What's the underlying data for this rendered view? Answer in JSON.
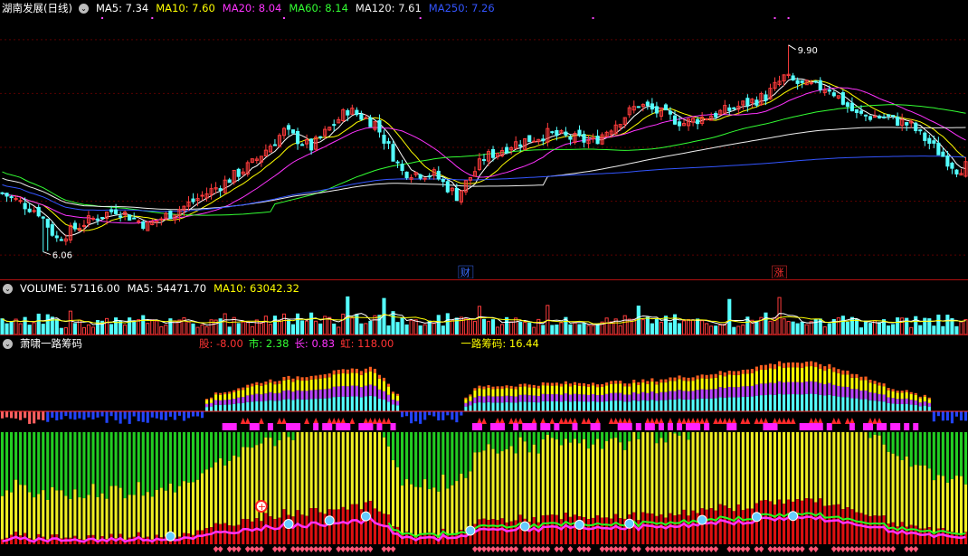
{
  "colors": {
    "up": "#ff3c3c",
    "down": "#54ffff",
    "ma5": "#ffffff",
    "ma10": "#ffff00",
    "ma20": "#ff33ff",
    "ma60": "#33ff33",
    "ma120": "#eeeeee",
    "ma250": "#3355ff",
    "grid": "#5a0000"
  },
  "price_panel": {
    "title": "湖南发展(日线)",
    "ma_labels": [
      {
        "text": "MA5: 7.34",
        "color": "#ffffff"
      },
      {
        "text": "MA10: 7.60",
        "color": "#ffff00"
      },
      {
        "text": "MA20: 8.04",
        "color": "#ff33ff"
      },
      {
        "text": "MA60: 8.14",
        "color": "#33ff33"
      },
      {
        "text": "MA120: 7.61",
        "color": "#eeeeee"
      },
      {
        "text": "MA250: 7.26",
        "color": "#3355ff"
      }
    ],
    "high_label": "9.90",
    "low_label": "6.06",
    "markers": [
      {
        "text": "财",
        "color": "#3a6cff"
      },
      {
        "text": "涨",
        "color": "#ff3030"
      }
    ]
  },
  "volume_panel": {
    "labels": [
      {
        "text": "VOLUME: 57116.00",
        "color": "#ffffff"
      },
      {
        "text": "MA5: 54471.70",
        "color": "#ffffff"
      },
      {
        "text": "MA10: 63042.32",
        "color": "#ffff00"
      }
    ]
  },
  "indicator_panel": {
    "title": "萧啸一路筹码",
    "labels": [
      {
        "text": "股: -8.00",
        "color": "#ff3333"
      },
      {
        "text": "市: 2.38",
        "color": "#33ff33"
      },
      {
        "text": "长: 0.83",
        "color": "#ff33ff"
      },
      {
        "text": "虹: 118.00",
        "color": "#ff3333"
      },
      {
        "text": "一路筹码: 16.44",
        "color": "#ffff00"
      }
    ]
  },
  "chart_data": [
    {
      "type": "candlestick",
      "series": [
        {
          "name": "湖南发展(日线)"
        }
      ],
      "ylim": [
        5.7,
        10.4
      ],
      "x_count": 213,
      "high": 9.9,
      "low": 6.06,
      "keypoints": [
        [
          0,
          7.15
        ],
        [
          8,
          6.8
        ],
        [
          12,
          6.3
        ],
        [
          18,
          6.6
        ],
        [
          25,
          6.85
        ],
        [
          32,
          6.55
        ],
        [
          40,
          6.9
        ],
        [
          48,
          7.3
        ],
        [
          55,
          7.7
        ],
        [
          62,
          8.3
        ],
        [
          68,
          8.0
        ],
        [
          76,
          8.7
        ],
        [
          82,
          8.45
        ],
        [
          88,
          7.55
        ],
        [
          95,
          7.5
        ],
        [
          100,
          7.1
        ],
        [
          106,
          7.8
        ],
        [
          112,
          8.05
        ],
        [
          120,
          8.25
        ],
        [
          130,
          8.1
        ],
        [
          140,
          8.8
        ],
        [
          150,
          8.45
        ],
        [
          160,
          8.7
        ],
        [
          168,
          8.95
        ],
        [
          172,
          9.3
        ],
        [
          176,
          9.15
        ],
        [
          182,
          9.1
        ],
        [
          188,
          8.6
        ],
        [
          195,
          8.55
        ],
        [
          200,
          8.4
        ],
        [
          205,
          8.0
        ],
        [
          210,
          7.6
        ],
        [
          212,
          7.65
        ]
      ]
    },
    {
      "type": "bar",
      "series": [
        {
          "name": "VOLUME"
        }
      ],
      "ylim": [
        0,
        160000
      ],
      "last": 57116,
      "ma5": 54471.7,
      "ma10": 63042.32
    },
    {
      "type": "bar",
      "series": [
        {
          "name": "一路筹码"
        }
      ],
      "last": 16.44,
      "keypoints": [
        [
          0,
          5
        ],
        [
          20,
          4
        ],
        [
          40,
          8
        ],
        [
          57,
          30
        ],
        [
          70,
          38
        ],
        [
          82,
          44
        ],
        [
          88,
          10
        ],
        [
          100,
          8
        ],
        [
          105,
          25
        ],
        [
          120,
          28
        ],
        [
          140,
          30
        ],
        [
          160,
          40
        ],
        [
          172,
          50
        ],
        [
          180,
          48
        ],
        [
          188,
          38
        ],
        [
          195,
          25
        ],
        [
          205,
          12
        ],
        [
          212,
          10
        ]
      ]
    }
  ]
}
